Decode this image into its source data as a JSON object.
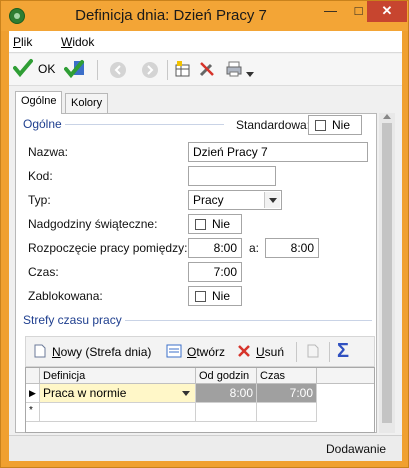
{
  "window": {
    "title": "Definicja dnia: Dzień Pracy 7",
    "close_symbol": "✕",
    "maximize_symbol": "□",
    "minimize_symbol": "—"
  },
  "menu": {
    "items": [
      {
        "accel": "P",
        "rest": "lik"
      },
      {
        "accel": "W",
        "rest": "idok"
      }
    ]
  },
  "toolbar": {
    "ok_label": "OK",
    "icons": [
      "save-check-icon",
      "save-and-new-icon",
      "back-icon",
      "forward-icon",
      "grid-settings-icon",
      "tools-icon",
      "print-icon",
      "dropdown-chevron-icon"
    ]
  },
  "tabs": [
    {
      "label": "Ogólne",
      "active": true
    },
    {
      "label": "Kolory",
      "active": false
    }
  ],
  "form": {
    "section_general": "Ogólne",
    "standard_label": "Standardowa:",
    "standard_value": "Nie",
    "name_label": "Nazwa:",
    "name_value": "Dzień Pracy 7",
    "code_label": "Kod:",
    "code_value": "",
    "type_label": "Typ:",
    "type_value": "Pracy",
    "holiday_overtime_label": "Nadgodziny świąteczne:",
    "holiday_overtime_value": "Nie",
    "work_start_label": "Rozpoczęcie pracy pomiędzy:",
    "work_start_from": "8:00",
    "work_start_sep": "a:",
    "work_start_to": "8:00",
    "duration_label": "Czas:",
    "duration_value": "7:00",
    "locked_label": "Zablokowana:",
    "locked_value": "Nie",
    "section_zones": "Strefy czasu pracy"
  },
  "zones_toolbar": {
    "new_accel": "N",
    "new_rest": "owy (Strefa dnia)",
    "open_accel": "O",
    "open_rest": "twórz",
    "delete_accel": "U",
    "delete_rest": "suń",
    "sum_symbol": "Σ"
  },
  "zones_grid": {
    "columns": [
      "Definicja",
      "Od godzin",
      "Czas"
    ],
    "rows": [
      {
        "marker": "▶",
        "definition": "Praca w normie",
        "from": "8:00",
        "duration": "7:00"
      }
    ],
    "new_row_marker": "*"
  },
  "status": {
    "mode": "Dodawanie"
  },
  "colors": {
    "accent": "#f0a030",
    "section_title": "#1f3f8f",
    "ok_green": "#2f9e35",
    "delete_red": "#d6332a",
    "sum_blue": "#3050c0",
    "selected_row": "#fff7c8",
    "readonly_cell": "#a0a0a0"
  }
}
